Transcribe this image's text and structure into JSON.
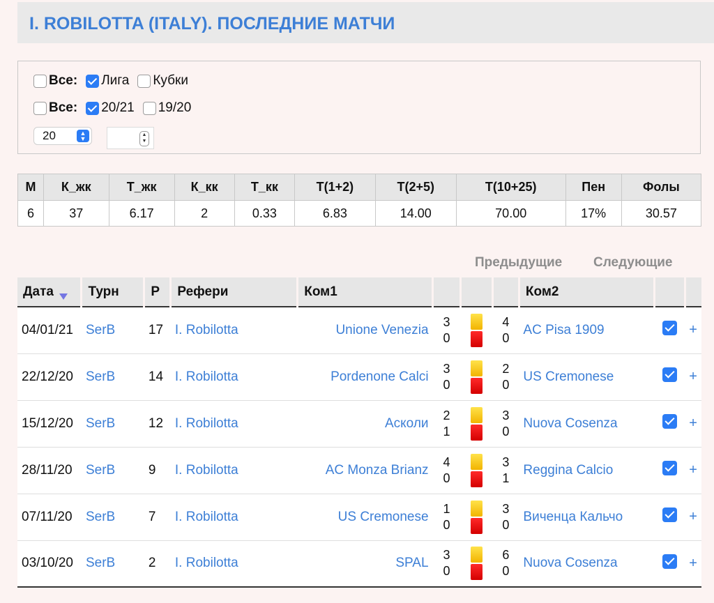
{
  "title": "I. ROBILOTTA (ITALY). ПОСЛЕДНИЕ МАТЧИ",
  "filters": {
    "row1": [
      {
        "label": "Все:",
        "checked": false,
        "bold": true
      },
      {
        "label": "Лига",
        "checked": true,
        "bold": false
      },
      {
        "label": "Кубки",
        "checked": false,
        "bold": false
      }
    ],
    "row2": [
      {
        "label": "Все:",
        "checked": false,
        "bold": true
      },
      {
        "label": "20/21",
        "checked": true,
        "bold": false
      },
      {
        "label": "19/20",
        "checked": false,
        "bold": false
      }
    ],
    "count_select": "20",
    "spin_value": ""
  },
  "stats": {
    "headers": [
      "М",
      "К_жк",
      "Т_жк",
      "К_кк",
      "Т_кк",
      "Т(1+2)",
      "Т(2+5)",
      "Т(10+25)",
      "Пен",
      "Фолы"
    ],
    "values": [
      "6",
      "37",
      "6.17",
      "2",
      "0.33",
      "6.83",
      "14.00",
      "70.00",
      "17%",
      "30.57"
    ]
  },
  "pager": {
    "prev": "Предыдущие",
    "next": "Следующие"
  },
  "matches": {
    "headers": {
      "date": "Дата",
      "tour": "Турн",
      "round": "Р",
      "referee": "Рефери",
      "team1": "Ком1",
      "team2": "Ком2"
    },
    "rows": [
      {
        "date": "04/01/21",
        "tour": "SerB",
        "round": "17",
        "referee": "I. Robilotta",
        "team1": "Unione Venezia",
        "y1": "3",
        "r1": "0",
        "y2": "4",
        "r2": "0",
        "team2": "AC Pisa 1909",
        "plus": "+"
      },
      {
        "date": "22/12/20",
        "tour": "SerB",
        "round": "14",
        "referee": "I. Robilotta",
        "team1": "Pordenone Calci",
        "y1": "3",
        "r1": "0",
        "y2": "2",
        "r2": "0",
        "team2": "US Cremonese",
        "plus": "+"
      },
      {
        "date": "15/12/20",
        "tour": "SerB",
        "round": "12",
        "referee": "I. Robilotta",
        "team1": "Асколи",
        "y1": "2",
        "r1": "1",
        "y2": "3",
        "r2": "0",
        "team2": "Nuova Cosenza",
        "plus": "+"
      },
      {
        "date": "28/11/20",
        "tour": "SerB",
        "round": "9",
        "referee": "I. Robilotta",
        "team1": "AC Monza Brianz",
        "y1": "4",
        "r1": "0",
        "y2": "3",
        "r2": "1",
        "team2": "Reggina Calcio",
        "plus": "+"
      },
      {
        "date": "07/11/20",
        "tour": "SerB",
        "round": "7",
        "referee": "I. Robilotta",
        "team1": "US Cremonese",
        "y1": "1",
        "r1": "0",
        "y2": "3",
        "r2": "0",
        "team2": "Виченца Кальчо",
        "plus": "+"
      },
      {
        "date": "03/10/20",
        "tour": "SerB",
        "round": "2",
        "referee": "I. Robilotta",
        "team1": "SPAL",
        "y1": "3",
        "r1": "0",
        "y2": "6",
        "r2": "0",
        "team2": "Nuova Cosenza",
        "plus": "+"
      }
    ]
  },
  "colors": {
    "accent": "#3d7fd6",
    "checkbox": "#2b7cf5",
    "yellow_card": "#f2b400",
    "red_card": "#d40000",
    "background": "#fcf3f2"
  }
}
